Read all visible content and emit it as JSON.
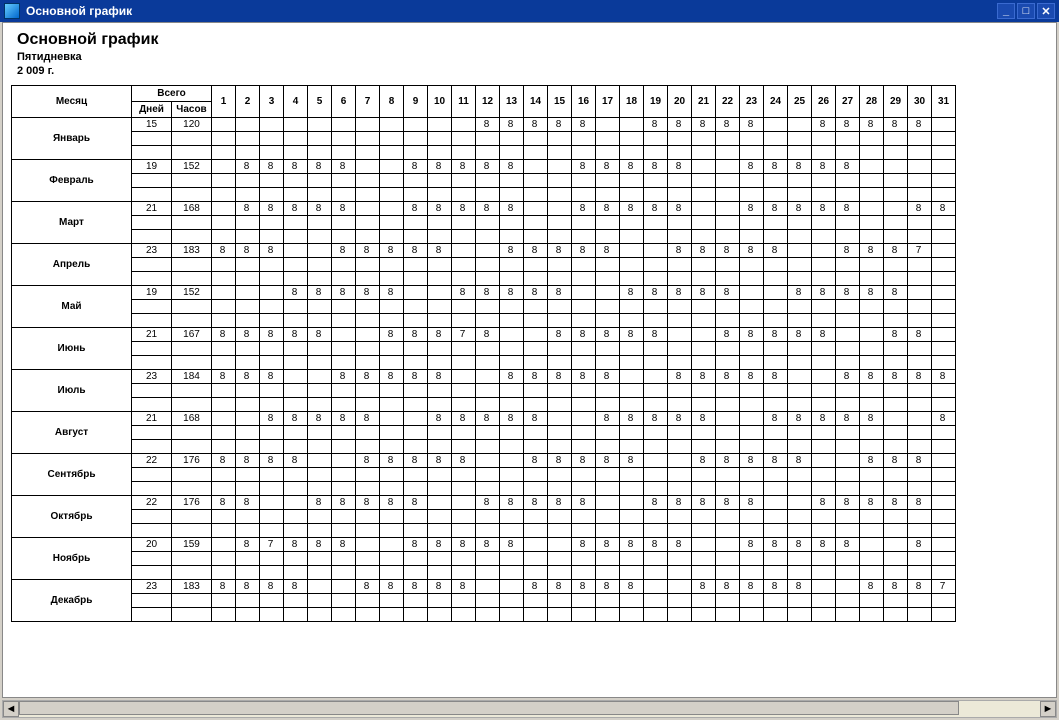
{
  "window": {
    "title": "Основной график"
  },
  "header": {
    "title": "Основной график",
    "subtitle1": "Пятидневка",
    "subtitle2": "2 009 г."
  },
  "columns": {
    "month_label": "Месяц",
    "total_label": "Всего",
    "days_label": "Дней",
    "hours_label": "Часов"
  },
  "day_numbers": [
    1,
    2,
    3,
    4,
    5,
    6,
    7,
    8,
    9,
    10,
    11,
    12,
    13,
    14,
    15,
    16,
    17,
    18,
    19,
    20,
    21,
    22,
    23,
    24,
    25,
    26,
    27,
    28,
    29,
    30,
    31
  ],
  "months": [
    {
      "name": "Январь",
      "days": 15,
      "hours": 120,
      "weekend": [
        1,
        2,
        3,
        4,
        5,
        6,
        7,
        8,
        9,
        10,
        11,
        17,
        18,
        24,
        25,
        31
      ],
      "row": [
        "",
        "",
        "",
        "",
        "",
        "",
        "",
        "",
        "",
        "",
        "",
        "8",
        "8",
        "8",
        "8",
        "8",
        "",
        "",
        "8",
        "8",
        "8",
        "8",
        "8",
        "",
        "",
        "8",
        "8",
        "8",
        "8",
        "8",
        ""
      ]
    },
    {
      "name": "Февраль",
      "days": 19,
      "hours": 152,
      "weekend": [
        1,
        7,
        8,
        14,
        15,
        21,
        22,
        28
      ],
      "grey": [
        29,
        30,
        31
      ],
      "row": [
        "",
        "8",
        "8",
        "8",
        "8",
        "8",
        "",
        "",
        "8",
        "8",
        "8",
        "8",
        "8",
        "",
        "",
        "8",
        "8",
        "8",
        "8",
        "8",
        "",
        "",
        "8",
        "8",
        "8",
        "8",
        "8",
        "",
        "",
        "",
        ""
      ]
    },
    {
      "name": "Март",
      "days": 21,
      "hours": 168,
      "weekend": [
        1,
        7,
        8,
        14,
        15,
        21,
        22,
        28,
        29
      ],
      "row": [
        "",
        "8",
        "8",
        "8",
        "8",
        "8",
        "",
        "",
        "8",
        "8",
        "8",
        "8",
        "8",
        "",
        "",
        "8",
        "8",
        "8",
        "8",
        "8",
        "",
        "",
        "8",
        "8",
        "8",
        "8",
        "8",
        "",
        "",
        "8",
        "8"
      ]
    },
    {
      "name": "Апрель",
      "days": 23,
      "hours": 183,
      "weekend": [
        4,
        5,
        11,
        12,
        18,
        19,
        25,
        26
      ],
      "grey": [
        31
      ],
      "row": [
        "8",
        "8",
        "8",
        "",
        "",
        "8",
        "8",
        "8",
        "8",
        "8",
        "",
        "",
        "8",
        "8",
        "8",
        "8",
        "8",
        "",
        "",
        "8",
        "8",
        "8",
        "8",
        "8",
        "",
        "",
        "8",
        "8",
        "8",
        "7",
        ""
      ]
    },
    {
      "name": "Май",
      "days": 19,
      "hours": 152,
      "weekend": [
        1,
        2,
        3,
        9,
        10,
        16,
        17,
        23,
        24,
        30,
        31
      ],
      "row": [
        "",
        "",
        "",
        "8",
        "8",
        "8",
        "8",
        "8",
        "",
        "",
        "8",
        "8",
        "8",
        "8",
        "8",
        "",
        "",
        "8",
        "8",
        "8",
        "8",
        "8",
        "",
        "",
        "8",
        "8",
        "8",
        "8",
        "8",
        "",
        ""
      ]
    },
    {
      "name": "Июнь",
      "days": 21,
      "hours": 167,
      "weekend": [
        6,
        7,
        13,
        14,
        20,
        21,
        27,
        28
      ],
      "grey": [
        31
      ],
      "row": [
        "8",
        "8",
        "8",
        "8",
        "8",
        "",
        "",
        "8",
        "8",
        "8",
        "7",
        "8",
        "",
        "",
        "8",
        "8",
        "8",
        "8",
        "8",
        "",
        "",
        "8",
        "8",
        "8",
        "8",
        "8",
        "",
        "",
        "8",
        "8",
        ""
      ]
    },
    {
      "name": "Июль",
      "days": 23,
      "hours": 184,
      "weekend": [
        4,
        5,
        11,
        12,
        18,
        19,
        25,
        26
      ],
      "row": [
        "8",
        "8",
        "8",
        "",
        "",
        "8",
        "8",
        "8",
        "8",
        "8",
        "",
        "",
        "8",
        "8",
        "8",
        "8",
        "8",
        "",
        "",
        "8",
        "8",
        "8",
        "8",
        "8",
        "",
        "",
        "8",
        "8",
        "8",
        "8",
        "8"
      ]
    },
    {
      "name": "Август",
      "days": 21,
      "hours": 168,
      "weekend": [
        1,
        2,
        8,
        9,
        15,
        16,
        22,
        23,
        29,
        30
      ],
      "row": [
        "",
        "",
        "8",
        "8",
        "8",
        "8",
        "8",
        "",
        "",
        "8",
        "8",
        "8",
        "8",
        "8",
        "",
        "",
        "8",
        "8",
        "8",
        "8",
        "8",
        "",
        "",
        "8",
        "8",
        "8",
        "8",
        "8",
        "",
        "",
        "8"
      ]
    },
    {
      "name": "Сентябрь",
      "days": 22,
      "hours": 176,
      "weekend": [
        5,
        6,
        12,
        13,
        19,
        20,
        26,
        27
      ],
      "grey": [
        31
      ],
      "row": [
        "8",
        "8",
        "8",
        "8",
        "",
        "",
        "8",
        "8",
        "8",
        "8",
        "8",
        "",
        "",
        "8",
        "8",
        "8",
        "8",
        "8",
        "",
        "",
        "8",
        "8",
        "8",
        "8",
        "8",
        "",
        "",
        "8",
        "8",
        "8",
        ""
      ]
    },
    {
      "name": "Октябрь",
      "days": 22,
      "hours": 176,
      "weekend": [
        3,
        4,
        10,
        11,
        17,
        18,
        24,
        25,
        31
      ],
      "row": [
        "8",
        "8",
        "",
        "",
        "8",
        "8",
        "8",
        "8",
        "8",
        "",
        "",
        "8",
        "8",
        "8",
        "8",
        "8",
        "",
        "",
        "8",
        "8",
        "8",
        "8",
        "8",
        "",
        "",
        "8",
        "8",
        "8",
        "8",
        "8",
        ""
      ]
    },
    {
      "name": "Ноябрь",
      "days": 20,
      "hours": 159,
      "weekend": [
        1,
        7,
        8,
        14,
        15,
        21,
        22,
        28,
        29
      ],
      "grey": [
        31
      ],
      "row": [
        "",
        "8",
        "7",
        "8",
        "8",
        "8",
        "",
        "",
        "8",
        "8",
        "8",
        "8",
        "8",
        "",
        "",
        "8",
        "8",
        "8",
        "8",
        "8",
        "",
        "",
        "8",
        "8",
        "8",
        "8",
        "8",
        "",
        "",
        "8",
        ""
      ]
    },
    {
      "name": "Декабрь",
      "days": 23,
      "hours": 183,
      "weekend": [
        5,
        6,
        12,
        13,
        19,
        20,
        26,
        27
      ],
      "row": [
        "8",
        "8",
        "8",
        "8",
        "",
        "",
        "8",
        "8",
        "8",
        "8",
        "8",
        "",
        "",
        "8",
        "8",
        "8",
        "8",
        "8",
        "",
        "",
        "8",
        "8",
        "8",
        "8",
        "8",
        "",
        "",
        "8",
        "8",
        "8",
        "7"
      ]
    }
  ],
  "highlighted_day": 3
}
